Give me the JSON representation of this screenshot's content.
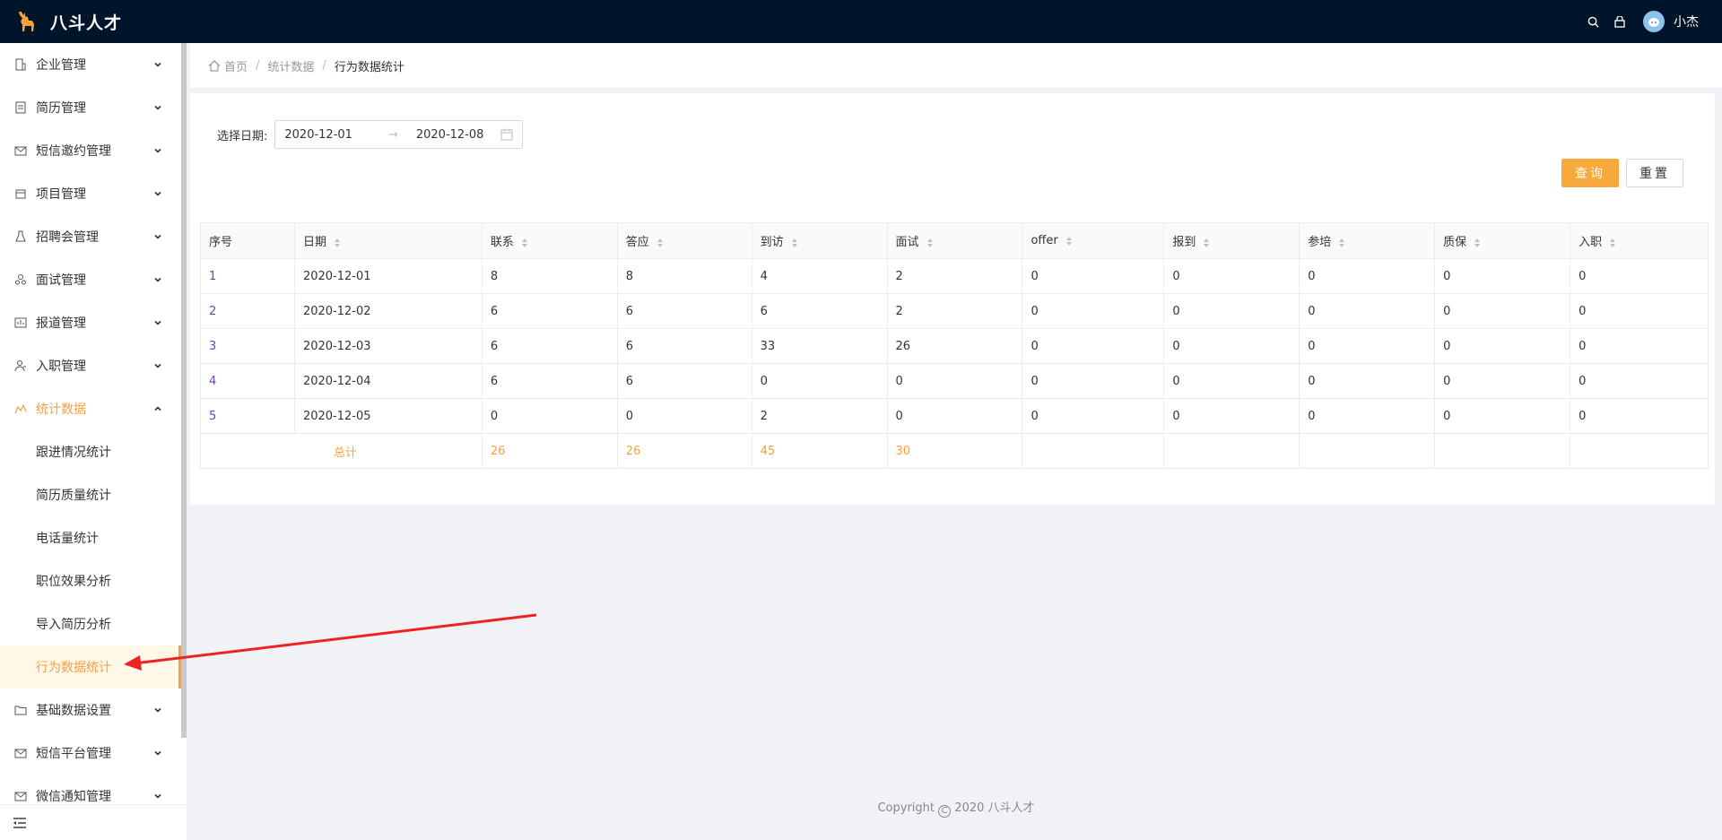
{
  "app": {
    "brand": "八斗人才",
    "username": "小杰",
    "accent_color": "#f7a03c"
  },
  "sidebar": {
    "items": [
      {
        "label": "企业管理",
        "icon": "building-icon"
      },
      {
        "label": "简历管理",
        "icon": "resume-icon"
      },
      {
        "label": "短信邀约管理",
        "icon": "mail-icon"
      },
      {
        "label": "项目管理",
        "icon": "project-icon"
      },
      {
        "label": "招聘会管理",
        "icon": "flask-icon"
      },
      {
        "label": "面试管理",
        "icon": "team-icon"
      },
      {
        "label": "报道管理",
        "icon": "report-icon"
      },
      {
        "label": "入职管理",
        "icon": "user-add-icon"
      },
      {
        "label": "统计数据",
        "icon": "chart-icon"
      }
    ],
    "sub_items": [
      "跟进情况统计",
      "简历质量统计",
      "电话量统计",
      "职位效果分析",
      "导入简历分析",
      "行为数据统计"
    ],
    "after_items": [
      {
        "label": "基础数据设置",
        "icon": "folder-icon"
      },
      {
        "label": "短信平台管理",
        "icon": "mail-icon"
      },
      {
        "label": "微信通知管理",
        "icon": "mail-icon"
      }
    ]
  },
  "breadcrumb": {
    "home": "首页",
    "section": "统计数据",
    "current": "行为数据统计"
  },
  "filter": {
    "label": "选择日期:",
    "start": "2020-12-01",
    "end": "2020-12-08"
  },
  "buttons": {
    "query": "查询",
    "reset": "重置"
  },
  "table": {
    "columns": [
      "序号",
      "日期",
      "联系",
      "答应",
      "到访",
      "面试",
      "offer",
      "报到",
      "参培",
      "质保",
      "入职"
    ],
    "rows": [
      [
        "1",
        "2020-12-01",
        "8",
        "8",
        "4",
        "2",
        "0",
        "0",
        "0",
        "0",
        "0"
      ],
      [
        "2",
        "2020-12-02",
        "6",
        "6",
        "6",
        "2",
        "0",
        "0",
        "0",
        "0",
        "0"
      ],
      [
        "3",
        "2020-12-03",
        "6",
        "6",
        "33",
        "26",
        "0",
        "0",
        "0",
        "0",
        "0"
      ],
      [
        "4",
        "2020-12-04",
        "6",
        "6",
        "0",
        "0",
        "0",
        "0",
        "0",
        "0",
        "0"
      ],
      [
        "5",
        "2020-12-05",
        "0",
        "0",
        "2",
        "0",
        "0",
        "0",
        "0",
        "0",
        "0"
      ]
    ],
    "total": {
      "label": "总计",
      "values": [
        "26",
        "26",
        "45",
        "30"
      ]
    }
  },
  "footer": {
    "copyright": "Copyright",
    "year_brand": "2020 八斗人才"
  }
}
